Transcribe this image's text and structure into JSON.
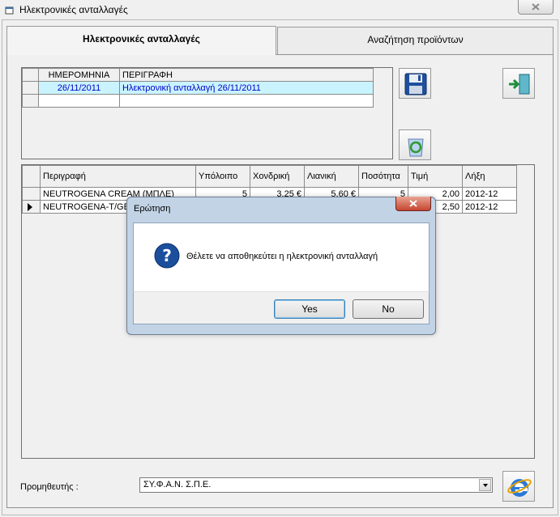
{
  "window": {
    "title": "Ηλεκτρονικές ανταλλαγές"
  },
  "tabs": [
    {
      "label": "Ηλεκτρονικές ανταλλαγές",
      "active": true
    },
    {
      "label": "Αναζήτηση προϊόντων",
      "active": false
    }
  ],
  "exchanges": {
    "headers": [
      "ΗΜΕΡΟΜΗΝΙΑ",
      "ΠΕΡΙΓΡΑΦΗ"
    ],
    "rows": [
      [
        "26/11/2011",
        "Ηλεκτρονική ανταλλαγή 26/11/2011"
      ]
    ]
  },
  "products": {
    "headers": [
      "Περιγραφή",
      "Υπόλοιπο",
      "Χονδρική",
      "Λιανική",
      "Ποσότητα",
      "Τιμή",
      "Λήξη"
    ],
    "rows": [
      [
        "NEUTROGENA CREAM (ΜΠΛΕ)",
        "5",
        "3,25 €",
        "5,60 €",
        "5",
        "2,00",
        "2012-12"
      ],
      [
        "NEUTROGENA-T/GE",
        "",
        "",
        "",
        "",
        "2,50",
        "2012-12"
      ]
    ]
  },
  "supplier": {
    "label": "Προμηθευτής :",
    "value": "ΣΥ.Φ.Α.Ν.  Σ.Π.Ε."
  },
  "dialog": {
    "title": "Ερώτηση",
    "message": "Θέλετε να αποθηκεύτει η ηλεκτρονική ανταλλαγή",
    "yes_label": "Yes",
    "no_label": "No"
  },
  "icons": {
    "save": "floppy-disk-icon",
    "exit": "exit-door-icon",
    "recycle": "recycle-bin-icon",
    "send": "internet-explorer-icon",
    "question": "question-icon"
  },
  "colors": {
    "selected_row": "#c9f4ff",
    "selected_text": "#0000c8"
  }
}
